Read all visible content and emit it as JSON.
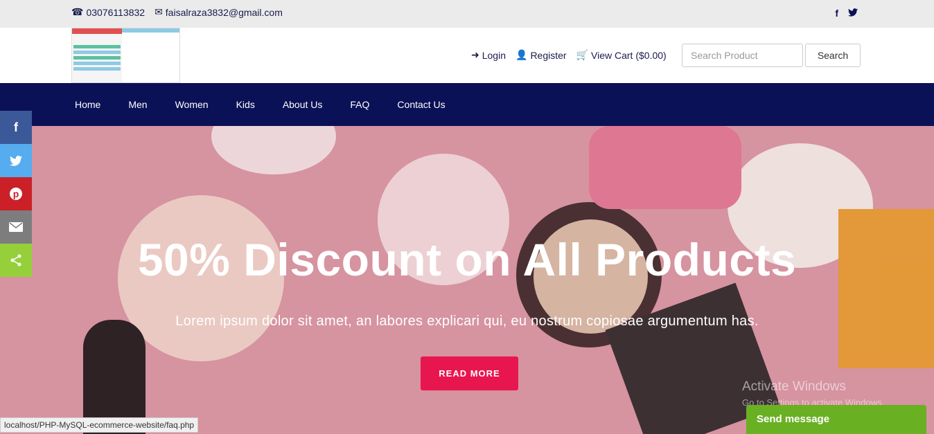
{
  "topbar": {
    "phone": "03076113832",
    "email": "faisalraza3832@gmail.com",
    "phone_icon": "☎",
    "email_icon": "✉",
    "facebook": "f",
    "twitter": "🐦"
  },
  "header": {
    "login": "Login",
    "register": "Register",
    "cart": "View Cart ($0.00)",
    "search_placeholder": "Search Product",
    "search_button": "Search"
  },
  "nav": {
    "items": [
      "Home",
      "Men",
      "Women",
      "Kids",
      "About Us",
      "FAQ",
      "Contact Us"
    ]
  },
  "hero": {
    "title": "50% Discount on All Products",
    "subtitle": "Lorem ipsum dolor sit amet, an labores explicari qui, eu nostrum copiosae argumentum has.",
    "button": "READ MORE"
  },
  "share": {
    "colors": [
      "#3b5998",
      "#55acee",
      "#cb2027",
      "#7d7d7d",
      "#95d03a"
    ]
  },
  "watermark": {
    "line1": "Activate Windows",
    "line2": "Go to Settings to activate Windows."
  },
  "statusbar": "localhost/PHP-MySQL-ecommerce-website/faq.php",
  "chat": {
    "label": "Send message"
  }
}
